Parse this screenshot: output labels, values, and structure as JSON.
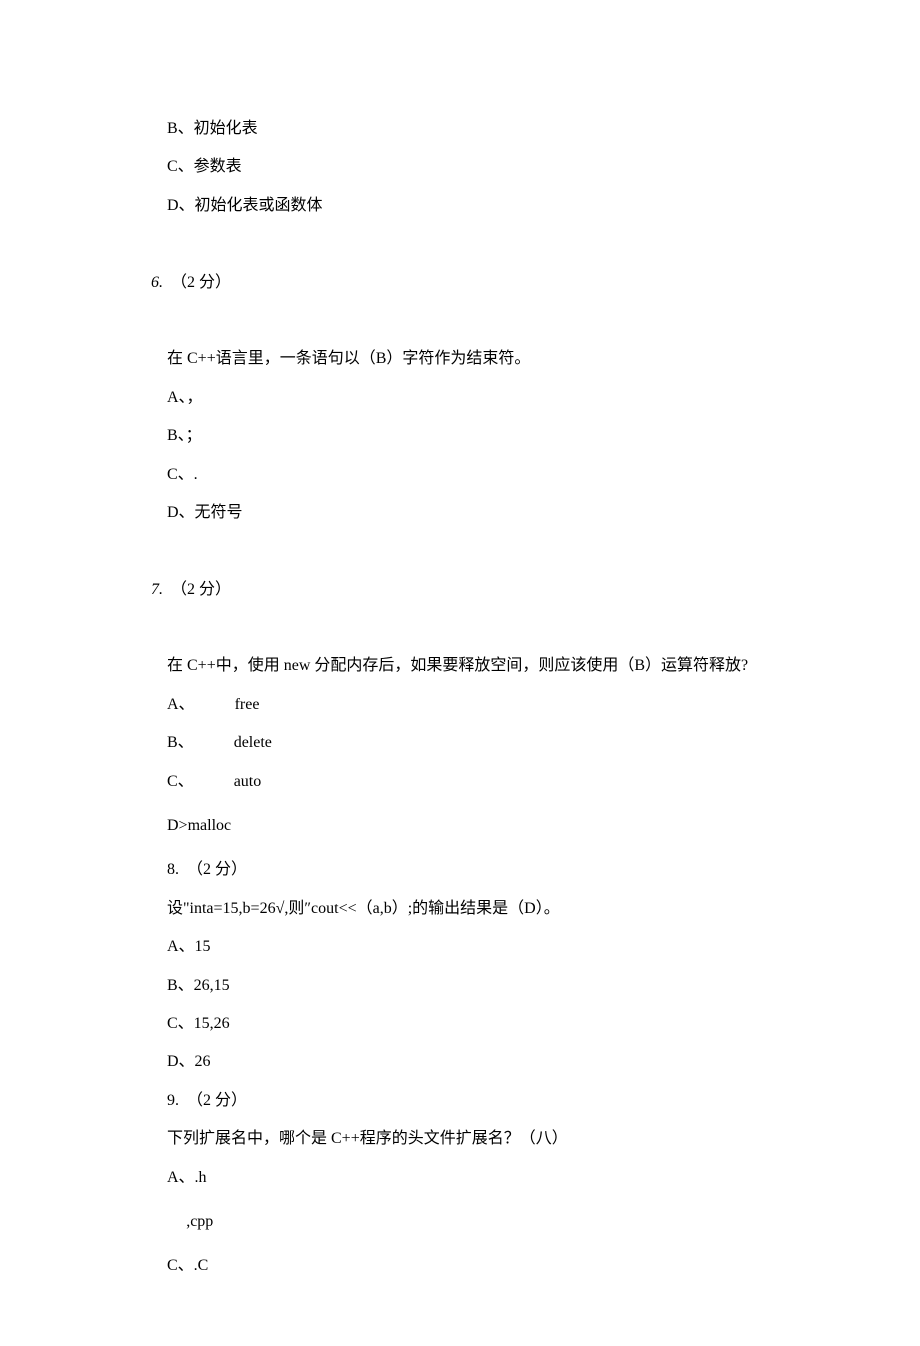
{
  "lines": {
    "l1": "B、初始化表",
    "l2": "C、参数表",
    "l3": "D、初始化表或函数体",
    "l4a": "6.",
    "l4b": "（2 分）",
    "l5": "在 C++语言里，一条语句以（B）字符作为结束符。",
    "l6": "A、，",
    "l7": "B、；",
    "l8": "C、.",
    "l9": "D、无符号",
    "l10a": "7.",
    "l10b": "（2 分）",
    "l11": "在 C++中，使用 new 分配内存后，如果要释放空间，则应该使用（B）运算符释放?",
    "l12a": "A、",
    "l12b": "free",
    "l13a": "B、",
    "l13b": "delete",
    "l14a": "C、",
    "l14b": "auto",
    "l15": "D>malloc",
    "l16": "8.  （2 分）",
    "l17": "设\"inta=15,b=26√,则″cout<<（a,b）;的输出结果是（D）。",
    "l18": "A、15",
    "l19": "B、26,15",
    "l20": "C、15,26",
    "l21": "D、26",
    "l22": "9.  （2 分）",
    "l23": "下列扩展名中，哪个是 C++程序的头文件扩展名？（八）",
    "l24": "A、.h",
    "l25": ",cpp",
    "l26": "C、.C"
  }
}
